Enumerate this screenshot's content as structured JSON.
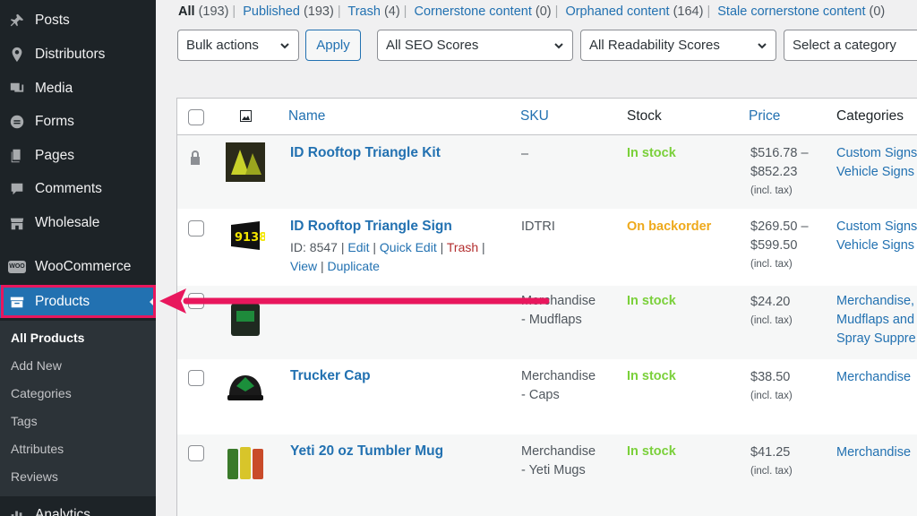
{
  "sidebar": {
    "items": [
      {
        "label": "Posts",
        "icon": "pin-icon"
      },
      {
        "label": "Distributors",
        "icon": "location-icon"
      },
      {
        "label": "Media",
        "icon": "media-icon"
      },
      {
        "label": "Forms",
        "icon": "forms-icon"
      },
      {
        "label": "Pages",
        "icon": "pages-icon"
      },
      {
        "label": "Comments",
        "icon": "comments-icon"
      },
      {
        "label": "Wholesale",
        "icon": "store-icon"
      },
      {
        "label": "WooCommerce",
        "icon": "woo-icon",
        "badge": "WOO"
      },
      {
        "label": "Products",
        "icon": "products-icon"
      }
    ],
    "submenu": [
      "All Products",
      "Add New",
      "Categories",
      "Tags",
      "Attributes",
      "Reviews"
    ],
    "bottom": {
      "label": "Analytics",
      "icon": "analytics-icon"
    }
  },
  "views": {
    "all": "All",
    "all_count": "(193)",
    "published": "Published",
    "published_count": "(193)",
    "trash": "Trash",
    "trash_count": "(4)",
    "cornerstone": "Cornerstone content",
    "cornerstone_count": "(0)",
    "orphaned": "Orphaned content",
    "orphaned_count": "(164)",
    "stale": "Stale cornerstone content",
    "stale_count": "(0)"
  },
  "filters": {
    "bulk": "Bulk actions",
    "apply": "Apply",
    "seo": "All SEO Scores",
    "readability": "All Readability Scores",
    "category": "Select a category"
  },
  "table": {
    "headers": {
      "name": "Name",
      "sku": "SKU",
      "stock": "Stock",
      "price": "Price",
      "categories": "Categories"
    },
    "rows": [
      {
        "name": "ID Rooftop Triangle Kit",
        "sku": "–",
        "stock": "In stock",
        "price1": "$516.78 –",
        "price2": "$852.23",
        "tax": "(incl. tax)",
        "cat1": "Custom Signs",
        "cat2": "Vehicle Signs"
      },
      {
        "name": "ID Rooftop Triangle Sign",
        "sku": "IDTRI",
        "stock": "On backorder",
        "price1": "$269.50 –",
        "price2": "$599.50",
        "tax": "(incl. tax)",
        "cat1": "Custom Signs",
        "cat2": "Vehicle Signs",
        "actions": {
          "id": "ID: 8547",
          "edit": "Edit",
          "quick": "Quick Edit",
          "trash": "Trash",
          "view": "View",
          "duplicate": "Duplicate"
        }
      },
      {
        "name": "",
        "sku1": "Merchandise",
        "sku2": "- Mudflaps",
        "stock": "In stock",
        "price1": "$24.20",
        "tax": "(incl. tax)",
        "cat1": "Merchandise,",
        "cat2": "Mudflaps and",
        "cat3": "Spray Suppre"
      },
      {
        "name": "Trucker Cap",
        "sku1": "Merchandise",
        "sku2": "- Caps",
        "stock": "In stock",
        "price1": "$38.50",
        "tax": "(incl. tax)",
        "cat1": "Merchandise"
      },
      {
        "name": "Yeti 20 oz Tumbler Mug",
        "sku1": "Merchandise",
        "sku2": "- Yeti Mugs",
        "stock": "In stock",
        "price1": "$41.25",
        "tax": "(incl. tax)",
        "cat1": "Merchandise"
      }
    ]
  },
  "colors": {
    "sidebar": "#1d2327",
    "active": "#2271b1",
    "link": "#2271b1",
    "in_stock": "#7ad03a",
    "backorder": "#eea91b",
    "annotation": "#e8175d"
  }
}
